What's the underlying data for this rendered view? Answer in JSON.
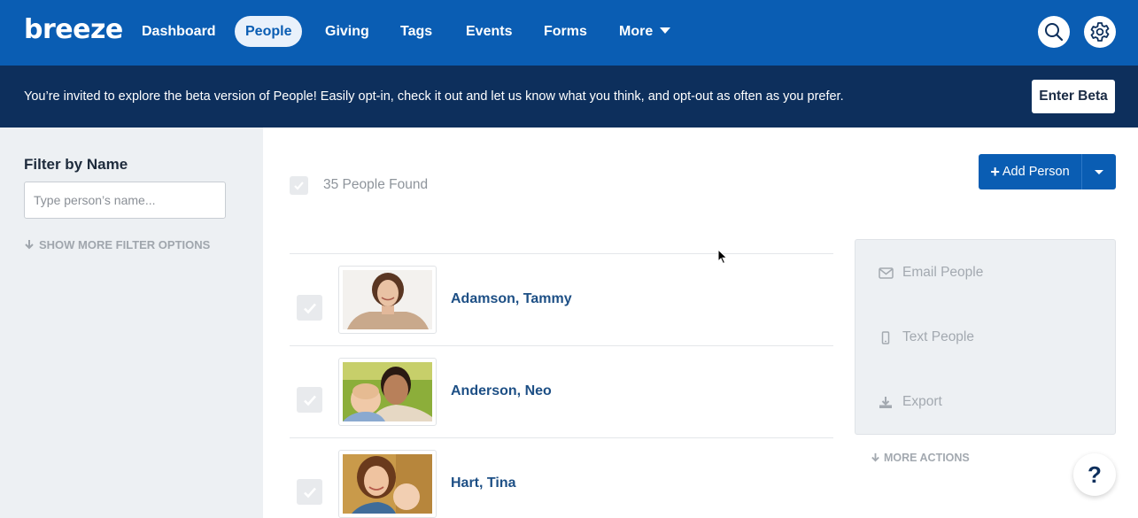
{
  "app": {
    "logo": "breeze"
  },
  "nav": {
    "items": [
      {
        "label": "Dashboard",
        "active": false
      },
      {
        "label": "People",
        "active": true
      },
      {
        "label": "Giving",
        "active": false
      },
      {
        "label": "Tags",
        "active": false
      },
      {
        "label": "Events",
        "active": false
      },
      {
        "label": "Forms",
        "active": false
      },
      {
        "label": "More",
        "active": false
      }
    ],
    "search_icon": "search-icon",
    "settings_icon": "gear-icon"
  },
  "banner": {
    "text": "You’re invited to explore the beta version of People! Easily opt-in, check it out and let us know what you think, and opt-out as often as you prefer.",
    "button_label": "Enter Beta"
  },
  "sidebar": {
    "filter_title": "Filter by Name",
    "filter_placeholder": "Type person’s name...",
    "filter_value": "",
    "show_more_label": "SHOW MORE FILTER OPTIONS"
  },
  "main": {
    "found_label": "35 People Found",
    "add_person_label": "Add Person",
    "people": [
      {
        "name": "Adamson, Tammy"
      },
      {
        "name": "Anderson, Neo"
      },
      {
        "name": "Hart, Tina"
      }
    ]
  },
  "actions": {
    "items": [
      {
        "label": "Email People",
        "icon": "envelope-icon"
      },
      {
        "label": "Text People",
        "icon": "mobile-phone-icon"
      },
      {
        "label": "Export",
        "icon": "download-icon"
      }
    ],
    "more_label": "MORE ACTIONS"
  },
  "help": {
    "label": "?"
  },
  "colors": {
    "brand_blue": "#0a5db3",
    "banner_navy": "#0d2f5c",
    "sidebar_bg": "#edf0f3",
    "name_link": "#1d4f85"
  }
}
